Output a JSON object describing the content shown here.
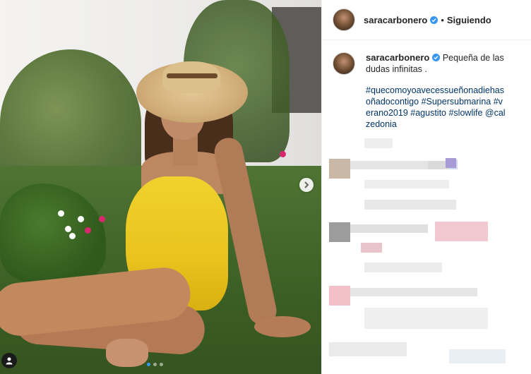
{
  "post": {
    "username": "saracarbonero",
    "separator": "•",
    "follow_status": "Siguiendo",
    "more_label": "•••",
    "caption": "Pequeña de las dudas infinitas .",
    "hashtags": [
      "#quecomoyoavecessueñonadiehasoñadocontigo",
      "#Supersubmarina",
      "#verano2019",
      "#agustito",
      "#slowlife",
      "@calzedonia"
    ]
  },
  "carousel": {
    "total": 3,
    "current": 1
  },
  "icons": {
    "verified": "verified-badge-icon",
    "next": "chevron-right-icon",
    "tag": "user-tag-icon"
  },
  "colors": {
    "verified": "#3897f0",
    "link": "#003569",
    "swimsuit": "#f1d12e"
  }
}
